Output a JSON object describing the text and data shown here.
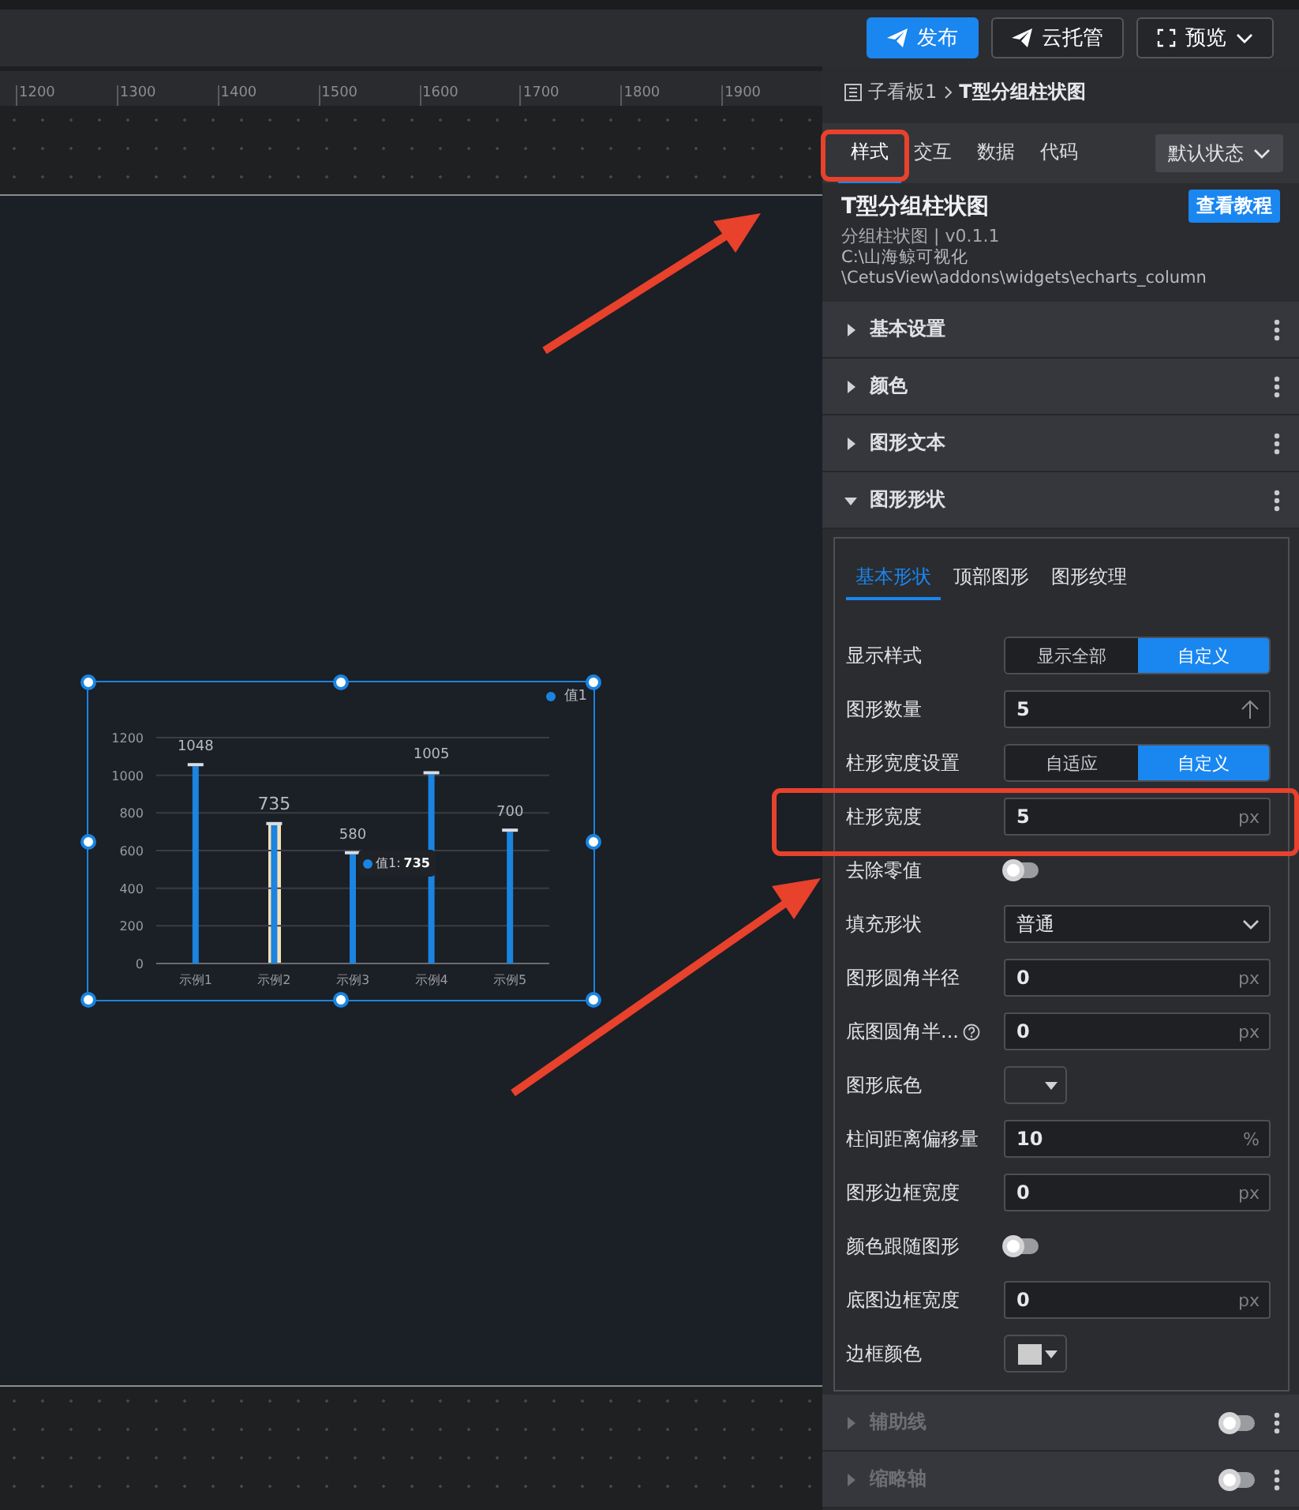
{
  "toolbar": {
    "buttons": [
      {
        "label": "发布",
        "kind": "primary"
      },
      {
        "label": "云托管",
        "kind": "plain"
      },
      {
        "label": "预览",
        "kind": "dropdown"
      }
    ]
  },
  "ruler": {
    "ticks": [
      "1200",
      "1300",
      "1400",
      "1500",
      "1600",
      "1700",
      "1800",
      "1900"
    ]
  },
  "canvas": {
    "widget": {
      "tooltip": {
        "label": "值1:",
        "value": "735"
      },
      "hovered": [
        false,
        true,
        false,
        false,
        false
      ],
      "chart_data": {
        "type": "bar",
        "categories": [
          "示例1",
          "示例2",
          "示例3",
          "示例4",
          "示例5"
        ],
        "series": [
          {
            "name": "值1",
            "color": "#1a84e0",
            "values": [
              1048,
              735,
              580,
              1005,
              700
            ]
          }
        ],
        "ylim": [
          0,
          1200
        ],
        "yticks": [
          0,
          200,
          400,
          600,
          800,
          1000,
          1200
        ],
        "grid": true,
        "data_labels": true
      }
    }
  },
  "panel": {
    "breadcrumb": [
      "子看板1",
      "T型分组柱状图"
    ],
    "tabs": [
      {
        "label": "样式",
        "selected": true
      },
      {
        "label": "交互",
        "selected": false
      },
      {
        "label": "数据",
        "selected": false
      },
      {
        "label": "代码",
        "selected": false
      }
    ],
    "state_select": "默认状态",
    "widget_info": {
      "title": "T型分组柱状图",
      "subtitle": "分组柱状图 | v0.1.1",
      "path": [
        "C:\\山海鲸可视化",
        "\\CetusView\\addons\\widgets\\echarts_column"
      ],
      "tutorial_button": "查看教程"
    },
    "sections": [
      {
        "label": "基本设置",
        "expanded": false,
        "disabled": false
      },
      {
        "label": "颜色",
        "expanded": false,
        "disabled": false
      },
      {
        "label": "图形文本",
        "expanded": false,
        "disabled": false
      },
      {
        "label": "图形形状",
        "expanded": true,
        "disabled": false
      }
    ],
    "subtabs": [
      {
        "label": "基本形状",
        "selected": true
      },
      {
        "label": "顶部图形",
        "selected": false
      },
      {
        "label": "图形纹理",
        "selected": false
      }
    ],
    "fields": [
      {
        "kind": "segmented",
        "label": "显示样式",
        "options": [
          {
            "label": "显示全部",
            "selected": false
          },
          {
            "label": "自定义",
            "selected": true
          }
        ]
      },
      {
        "kind": "number",
        "label": "图形数量",
        "value": "5"
      },
      {
        "kind": "segmented",
        "label": "柱形宽度设置",
        "options": [
          {
            "label": "自适应",
            "selected": false
          },
          {
            "label": "自定义",
            "selected": true
          }
        ]
      },
      {
        "kind": "unit",
        "label": "柱形宽度",
        "value": "5",
        "unit": "px"
      },
      {
        "kind": "toggle",
        "label": "去除零值",
        "on": false
      },
      {
        "kind": "select",
        "label": "填充形状",
        "value": "普通"
      },
      {
        "kind": "unit",
        "label": "图形圆角半径",
        "value": "0",
        "unit": "px"
      },
      {
        "kind": "unit",
        "label": "底图圆角半...",
        "value": "0",
        "unit": "px",
        "help": true
      },
      {
        "kind": "color",
        "label": "图形底色"
      },
      {
        "kind": "unit",
        "label": "柱间距离偏移量",
        "value": "10",
        "unit": "%"
      },
      {
        "kind": "unit",
        "label": "图形边框宽度",
        "value": "0",
        "unit": "px"
      },
      {
        "kind": "toggle",
        "label": "颜色跟随图形",
        "on": false
      },
      {
        "kind": "unit",
        "label": "底图边框宽度",
        "value": "0",
        "unit": "px"
      },
      {
        "kind": "color",
        "label": "边框颜色",
        "color": "#cccccc"
      }
    ],
    "footer_sections": [
      {
        "label": "辅助线",
        "expanded": false,
        "disabled": true,
        "on": false
      },
      {
        "label": "缩略轴",
        "expanded": false,
        "disabled": true,
        "on": false
      }
    ]
  }
}
